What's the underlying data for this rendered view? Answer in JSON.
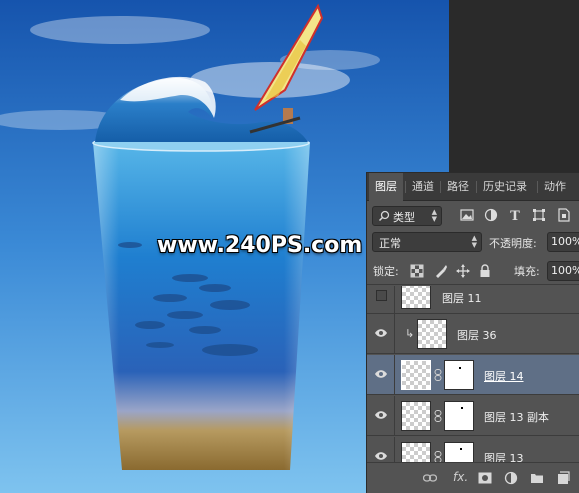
{
  "watermark": "www.240PS.com",
  "panel": {
    "tabs": [
      {
        "label": "图层",
        "active": true
      },
      {
        "label": "通道",
        "active": false
      },
      {
        "label": "路径",
        "active": false
      },
      {
        "label": "历史记录",
        "active": false
      },
      {
        "label": "动作",
        "active": false
      }
    ],
    "filter": {
      "label": "类型"
    },
    "blend_mode": "正常",
    "opacity_label": "不透明度:",
    "opacity_value": "100%",
    "lock_label": "锁定:",
    "fill_label": "填充:",
    "fill_value": "100%",
    "layers": [
      {
        "name": "图层 11",
        "visible": false,
        "has_mask": false,
        "clipped": false,
        "selected": false
      },
      {
        "name": "图层 36",
        "visible": true,
        "has_mask": false,
        "clipped": true,
        "selected": false
      },
      {
        "name": "图层 14",
        "visible": true,
        "has_mask": true,
        "clipped": false,
        "selected": true
      },
      {
        "name": "图层 13 副本",
        "visible": true,
        "has_mask": true,
        "clipped": false,
        "selected": false
      },
      {
        "name": "图层 13",
        "visible": true,
        "has_mask": true,
        "clipped": false,
        "selected": false
      }
    ],
    "bottom_icons": [
      "link-icon",
      "fx-icon",
      "add-mask-icon",
      "adjustment-layer-icon",
      "new-group-icon",
      "new-layer-icon"
    ],
    "fx_label": "fx."
  },
  "colors": {
    "panel_bg": "#535353",
    "selected_row": "#5f6f86",
    "sky_top": "#1a5cb3",
    "sky_bottom": "#6cb6ea"
  }
}
